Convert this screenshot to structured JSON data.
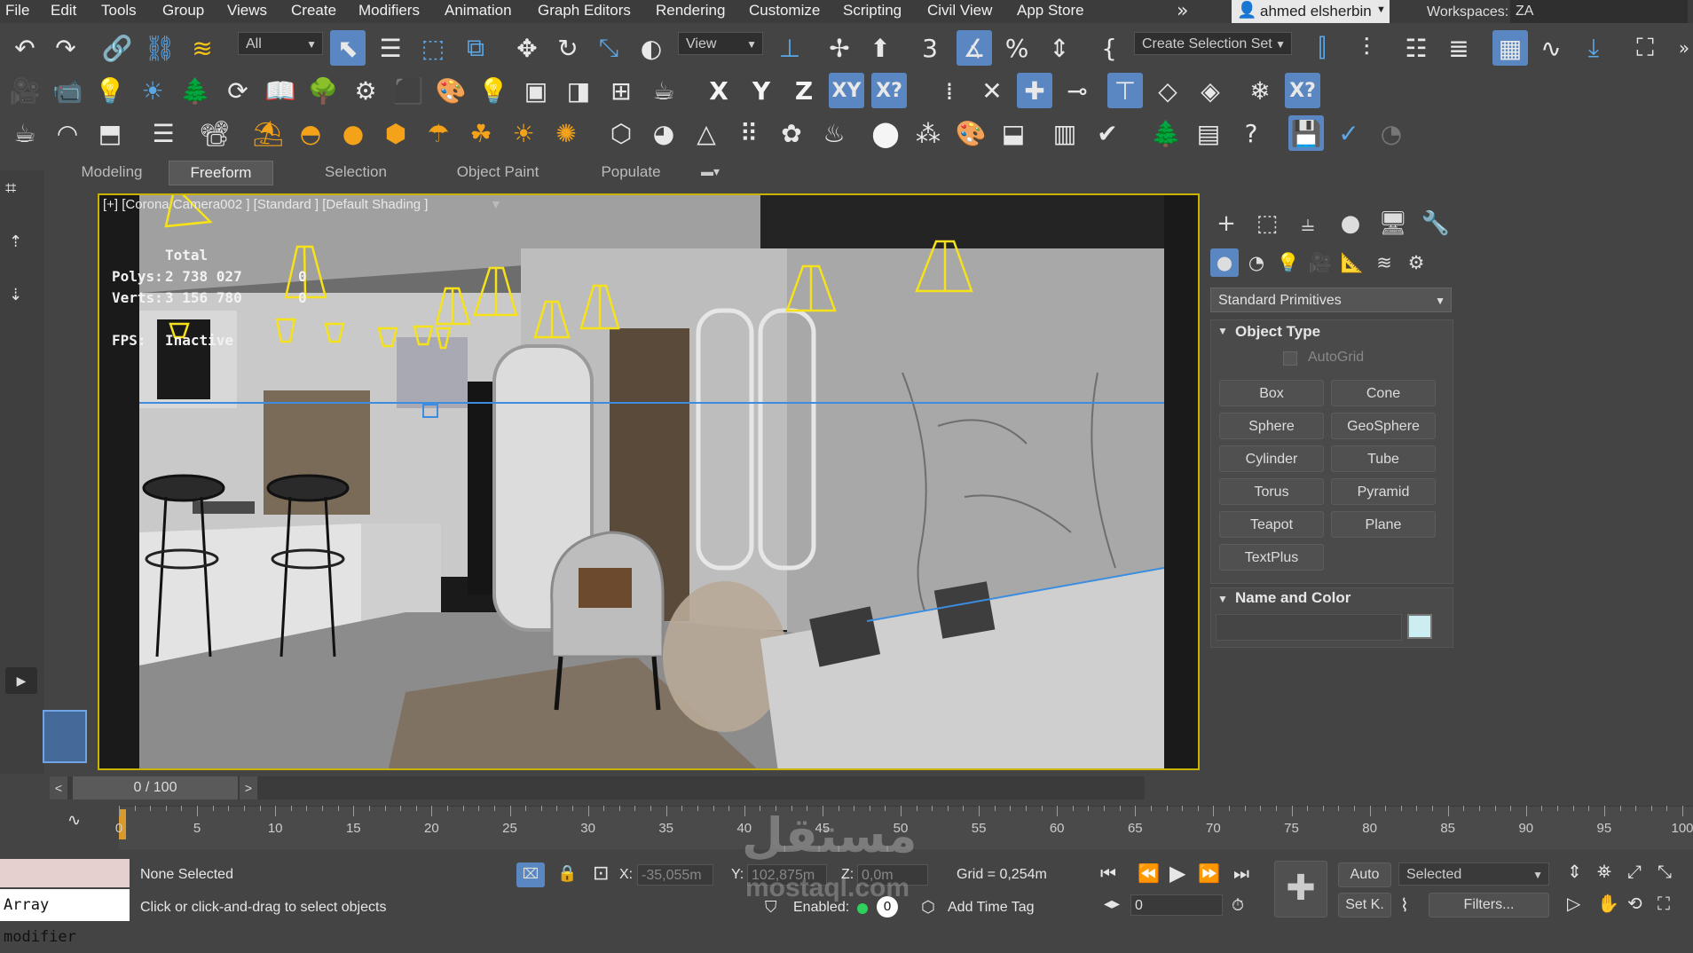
{
  "menu": [
    "File",
    "Edit",
    "Tools",
    "Group",
    "Views",
    "Create",
    "Modifiers",
    "Animation",
    "Graph Editors",
    "Rendering",
    "Customize",
    "Scripting",
    "Civil View",
    "App Store"
  ],
  "user_name": "ahmed elsherbin",
  "workspaces_label": "Workspaces:",
  "workspace_value": "ZA",
  "toolbar": {
    "filter_value": "All",
    "ref_coord_value": "View",
    "selection_set_placeholder": "Create Selection Set",
    "axis_x": "X",
    "axis_y": "Y",
    "axis_z": "Z",
    "axis_xy": "XY"
  },
  "ribbon_tabs": [
    "Modeling",
    "Freeform",
    "Selection",
    "Object Paint",
    "Populate"
  ],
  "ribbon_active": "Freeform",
  "viewport": {
    "label": "[+] [Corona Camera002 ] [Standard ] [Default Shading ]",
    "stats_total": "Total",
    "polys_label": "Polys:",
    "polys_value": "2 738 027",
    "polys_sel": "0",
    "verts_label": "Verts:",
    "verts_value": "3 156 780",
    "verts_sel": "0",
    "fps_label": "FPS:",
    "fps_value": "Inactive"
  },
  "command_panel": {
    "category": "Standard Primitives",
    "object_type_title": "Object Type",
    "autogrid_label": "AutoGrid",
    "primitives": [
      "Box",
      "Cone",
      "Sphere",
      "GeoSphere",
      "Cylinder",
      "Tube",
      "Torus",
      "Pyramid",
      "Teapot",
      "Plane",
      "TextPlus"
    ],
    "name_color_title": "Name and Color",
    "object_color": "#cdeef0"
  },
  "timeline": {
    "frame_display": "0 / 100",
    "ticks": [
      "0",
      "5",
      "10",
      "15",
      "20",
      "25",
      "30",
      "35",
      "40",
      "45",
      "50",
      "55",
      "60",
      "65",
      "70",
      "75",
      "80",
      "85",
      "90",
      "95",
      "100"
    ]
  },
  "status": {
    "maxscript_text": "Array modifier",
    "selection_status": "None Selected",
    "prompt": "Click or click-and-drag to select objects",
    "x_label": "X:",
    "x_value": "-35,055m",
    "y_label": "Y:",
    "y_value": "102,875m",
    "z_label": "Z:",
    "z_value": "0,0m",
    "grid_text": "Grid = 0,254m",
    "enabled_label": "Enabled:",
    "enabled_value": "0",
    "add_time_tag": "Add Time Tag",
    "frame_value": "0",
    "auto_key": "Auto",
    "set_key": "Set K.",
    "key_filter_value": "Selected",
    "filters_label": "Filters..."
  },
  "watermark": {
    "arabic": "مستقل",
    "latin": "mostaql.com"
  },
  "colors": {
    "accent_blue": "#5a87c2",
    "viewport_border": "#c8b400",
    "light_yellow": "#f5e21a"
  }
}
